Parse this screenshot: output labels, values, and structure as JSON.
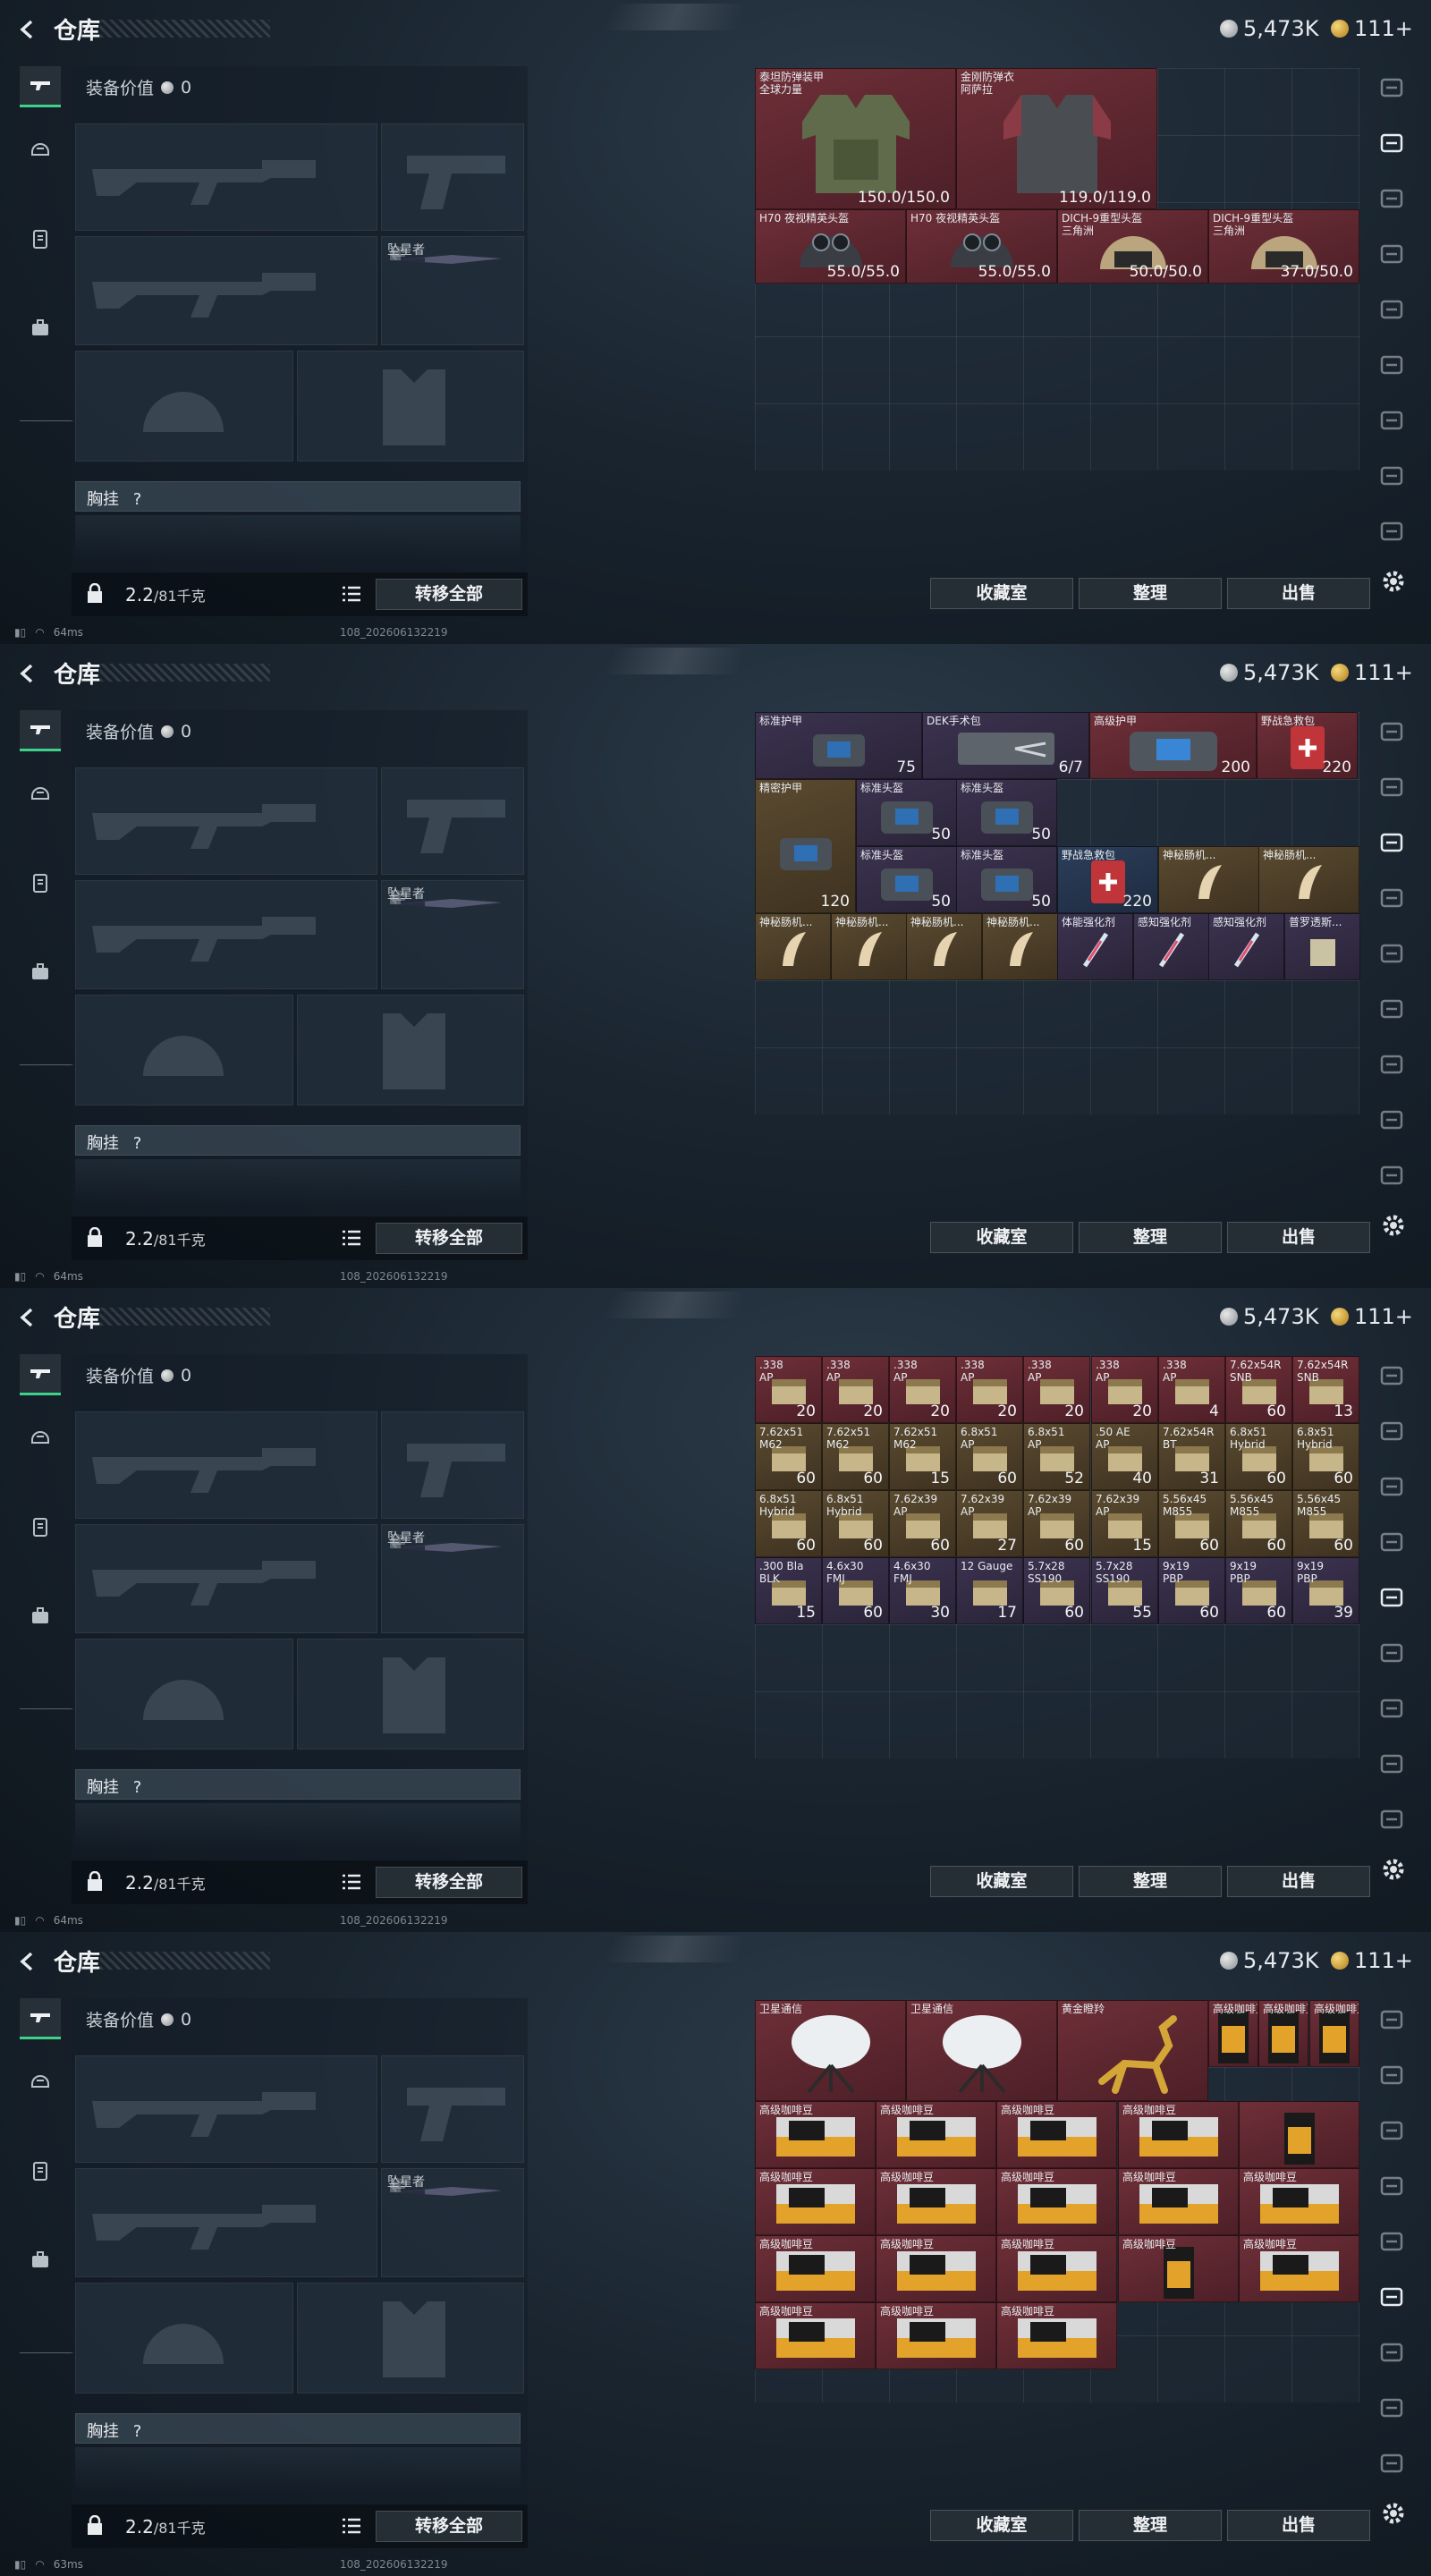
{
  "panels": [
    {
      "title": "仓库",
      "currency": {
        "silver": "5,473K",
        "gold": "111+"
      },
      "equip": {
        "value_label": "装备价值",
        "value": "0",
        "melee_name": "坠星者",
        "chest_label": "胸挂",
        "chest_help": "?",
        "weight": "2.2",
        "weight_max": "/81千克",
        "transfer_label": "转移全部"
      },
      "actions": {
        "collection": "收藏室",
        "sort": "整理",
        "sell": "出售"
      },
      "status": {
        "ping": "64ms",
        "build": "108_202606132219"
      },
      "items": [
        {
          "name": "泰坦防弹装甲",
          "sub": "全球力量",
          "value": "150.0/150.0",
          "rarity": "red",
          "art": "armor-green"
        },
        {
          "name": "金刚防弹衣",
          "sub": "阿萨拉",
          "value": "119.0/119.0",
          "rarity": "red",
          "art": "armor-red"
        },
        {
          "name": "H70 夜视精英头盔",
          "sub": "",
          "value": "55.0/55.0",
          "rarity": "red",
          "art": "helmet-nv"
        },
        {
          "name": "H70 夜视精英头盔",
          "sub": "",
          "value": "55.0/55.0",
          "rarity": "red",
          "art": "helmet-nv"
        },
        {
          "name": "DICH-9重型头盔",
          "sub": "三角洲",
          "value": "50.0/50.0",
          "rarity": "red",
          "art": "helmet-tan"
        },
        {
          "name": "DICH-9重型头盔",
          "sub": "三角洲",
          "value": "37.0/50.0",
          "rarity": "red",
          "art": "helmet-tan"
        }
      ]
    },
    {
      "title": "仓库",
      "currency": {
        "silver": "5,473K",
        "gold": "111+"
      },
      "equip": {
        "value_label": "装备价值",
        "value": "0",
        "melee_name": "坠星者",
        "chest_label": "胸挂",
        "chest_help": "?",
        "weight": "2.2",
        "weight_max": "/81千克",
        "transfer_label": "转移全部"
      },
      "actions": {
        "collection": "收藏室",
        "sort": "整理",
        "sell": "出售"
      },
      "status": {
        "ping": "64ms",
        "build": "108_202606132219"
      },
      "items": [
        {
          "name": "标准护甲",
          "value": "75",
          "rarity": "purple",
          "art": "kit-blue"
        },
        {
          "name": "DEK手术包",
          "value": "6/7",
          "rarity": "purple",
          "art": "surgery"
        },
        {
          "name": "高级护甲",
          "value": "200",
          "rarity": "red",
          "art": "kit-big"
        },
        {
          "name": "野战急救包",
          "value": "220",
          "rarity": "red",
          "art": "medkit"
        },
        {
          "name": "精密护甲",
          "value": "120",
          "rarity": "gold",
          "art": "kit-blue"
        },
        {
          "name": "标准头盔",
          "value": "50",
          "rarity": "purple",
          "art": "kit-small"
        },
        {
          "name": "标准头盔",
          "value": "50",
          "rarity": "purple",
          "art": "kit-small"
        },
        {
          "name": "标准头盔",
          "value": "50",
          "rarity": "purple",
          "art": "kit-small"
        },
        {
          "name": "标准头盔",
          "value": "50",
          "rarity": "purple",
          "art": "kit-small"
        },
        {
          "name": "野战急救包",
          "value": "220",
          "rarity": "blue",
          "art": "medkit"
        },
        {
          "name": "神秘肠机...",
          "value": "",
          "rarity": "gold",
          "art": "horn"
        },
        {
          "name": "神秘肠机...",
          "value": "",
          "rarity": "gold",
          "art": "horn"
        },
        {
          "name": "神秘肠机...",
          "value": "",
          "rarity": "gold",
          "art": "horn"
        },
        {
          "name": "神秘肠机...",
          "value": "",
          "rarity": "gold",
          "art": "horn"
        },
        {
          "name": "神秘肠机...",
          "value": "",
          "rarity": "gold",
          "art": "horn"
        },
        {
          "name": "神秘肠机...",
          "value": "",
          "rarity": "gold",
          "art": "horn"
        },
        {
          "name": "体能强化剂",
          "value": "",
          "rarity": "purple",
          "art": "syringe"
        },
        {
          "name": "感知强化剂",
          "value": "",
          "rarity": "purple",
          "art": "syringe"
        },
        {
          "name": "感知强化剂",
          "value": "",
          "rarity": "purple",
          "art": "syringe"
        },
        {
          "name": "普罗透斯...",
          "value": "",
          "rarity": "purple",
          "art": "bag"
        }
      ]
    },
    {
      "title": "仓库",
      "currency": {
        "silver": "5,473K",
        "gold": "111+"
      },
      "equip": {
        "value_label": "装备价值",
        "value": "0",
        "melee_name": "坠星者",
        "chest_label": "胸挂",
        "chest_help": "?",
        "weight": "2.2",
        "weight_max": "/81千克",
        "transfer_label": "转移全部"
      },
      "actions": {
        "collection": "收藏室",
        "sort": "整理",
        "sell": "出售"
      },
      "status": {
        "ping": "64ms",
        "build": "108_202606132219"
      },
      "items": [
        {
          "name": ".338",
          "sub": "AP",
          "value": "20",
          "rarity": "red"
        },
        {
          "name": ".338",
          "sub": "AP",
          "value": "20",
          "rarity": "red"
        },
        {
          "name": ".338",
          "sub": "AP",
          "value": "20",
          "rarity": "red"
        },
        {
          "name": ".338",
          "sub": "AP",
          "value": "20",
          "rarity": "red"
        },
        {
          "name": ".338",
          "sub": "AP",
          "value": "20",
          "rarity": "red"
        },
        {
          "name": ".338",
          "sub": "AP",
          "value": "20",
          "rarity": "red"
        },
        {
          "name": ".338",
          "sub": "AP",
          "value": "4",
          "rarity": "red"
        },
        {
          "name": "7.62x54R",
          "sub": "SNB",
          "value": "60",
          "rarity": "red"
        },
        {
          "name": "7.62x54R",
          "sub": "SNB",
          "value": "13",
          "rarity": "red"
        },
        {
          "name": "7.62x51",
          "sub": "M62",
          "value": "60",
          "rarity": "gold"
        },
        {
          "name": "7.62x51",
          "sub": "M62",
          "value": "60",
          "rarity": "gold"
        },
        {
          "name": "7.62x51",
          "sub": "M62",
          "value": "15",
          "rarity": "gold"
        },
        {
          "name": "6.8x51",
          "sub": "AP",
          "value": "60",
          "rarity": "gold"
        },
        {
          "name": "6.8x51",
          "sub": "AP",
          "value": "52",
          "rarity": "gold"
        },
        {
          "name": ".50 AE",
          "sub": "AP",
          "value": "40",
          "rarity": "gold"
        },
        {
          "name": "7.62x54R",
          "sub": "BT",
          "value": "31",
          "rarity": "gold"
        },
        {
          "name": "6.8x51",
          "sub": "Hybrid",
          "value": "60",
          "rarity": "gold"
        },
        {
          "name": "6.8x51",
          "sub": "Hybrid",
          "value": "60",
          "rarity": "gold"
        },
        {
          "name": "6.8x51",
          "sub": "Hybrid",
          "value": "60",
          "rarity": "gold"
        },
        {
          "name": "6.8x51",
          "sub": "Hybrid",
          "value": "60",
          "rarity": "gold"
        },
        {
          "name": "7.62x39",
          "sub": "AP",
          "value": "60",
          "rarity": "gold"
        },
        {
          "name": "7.62x39",
          "sub": "AP",
          "value": "27",
          "rarity": "gold"
        },
        {
          "name": "7.62x39",
          "sub": "AP",
          "value": "60",
          "rarity": "gold"
        },
        {
          "name": "7.62x39",
          "sub": "AP",
          "value": "15",
          "rarity": "gold"
        },
        {
          "name": "5.56x45",
          "sub": "M855",
          "value": "60",
          "rarity": "gold"
        },
        {
          "name": "5.56x45",
          "sub": "M855",
          "value": "60",
          "rarity": "gold"
        },
        {
          "name": "5.56x45",
          "sub": "M855",
          "value": "60",
          "rarity": "gold"
        },
        {
          "name": ".300 Bla",
          "sub": "BLK",
          "value": "15",
          "rarity": "purple"
        },
        {
          "name": "4.6x30",
          "sub": "FMJ",
          "value": "60",
          "rarity": "purple"
        },
        {
          "name": "4.6x30",
          "sub": "FMJ",
          "value": "30",
          "rarity": "purple"
        },
        {
          "name": "12 Gauge",
          "sub": "",
          "value": "17",
          "rarity": "purple"
        },
        {
          "name": "5.7x28",
          "sub": "SS190",
          "value": "60",
          "rarity": "purple"
        },
        {
          "name": "5.7x28",
          "sub": "SS190",
          "value": "55",
          "rarity": "purple"
        },
        {
          "name": "9x19",
          "sub": "PBP",
          "value": "60",
          "rarity": "purple"
        },
        {
          "name": "9x19",
          "sub": "PBP",
          "value": "60",
          "rarity": "purple"
        },
        {
          "name": "9x19",
          "sub": "PBP",
          "value": "39",
          "rarity": "purple"
        }
      ]
    },
    {
      "title": "仓库",
      "currency": {
        "silver": "5,473K",
        "gold": "111+"
      },
      "equip": {
        "value_label": "装备价值",
        "value": "0",
        "melee_name": "坠星者",
        "chest_label": "胸挂",
        "chest_help": "?",
        "weight": "2.2",
        "weight_max": "/81千克",
        "transfer_label": "转移全部"
      },
      "actions": {
        "collection": "收藏室",
        "sort": "整理",
        "sell": "出售"
      },
      "status": {
        "ping": "63ms",
        "build": "108_202606132219"
      },
      "items": [
        {
          "name": "卫星通信",
          "value": "",
          "rarity": "red",
          "art": "dish"
        },
        {
          "name": "卫星通信",
          "value": "",
          "rarity": "red",
          "art": "dish"
        },
        {
          "name": "黄金瞪羚",
          "value": "",
          "rarity": "red",
          "art": "gazelle"
        },
        {
          "name": "高级咖啡豆",
          "value": "",
          "rarity": "red",
          "art": "coffee-bag"
        },
        {
          "name": "高级咖啡豆",
          "value": "",
          "rarity": "red",
          "art": "coffee-bag"
        },
        {
          "name": "高级咖啡豆",
          "value": "",
          "rarity": "red",
          "art": "coffee-bag"
        },
        {
          "name": "高级咖啡豆",
          "value": "",
          "rarity": "red",
          "art": "coffee-box"
        },
        {
          "name": "高级咖啡豆",
          "value": "",
          "rarity": "red",
          "art": "coffee-box"
        },
        {
          "name": "高级咖啡豆",
          "value": "",
          "rarity": "red",
          "art": "coffee-box"
        },
        {
          "name": "高级咖啡豆",
          "value": "",
          "rarity": "red",
          "art": "coffee-box"
        },
        {
          "name": "",
          "value": "",
          "rarity": "red",
          "art": "coffee-bag"
        },
        {
          "name": "高级咖啡豆",
          "value": "",
          "rarity": "red",
          "art": "coffee-box"
        },
        {
          "name": "高级咖啡豆",
          "value": "",
          "rarity": "red",
          "art": "coffee-box"
        },
        {
          "name": "高级咖啡豆",
          "value": "",
          "rarity": "red",
          "art": "coffee-box"
        },
        {
          "name": "高级咖啡豆",
          "value": "",
          "rarity": "red",
          "art": "coffee-box"
        },
        {
          "name": "高级咖啡豆",
          "value": "",
          "rarity": "red",
          "art": "coffee-box"
        },
        {
          "name": "高级咖啡豆",
          "value": "",
          "rarity": "red",
          "art": "coffee-box"
        },
        {
          "name": "高级咖啡豆",
          "value": "",
          "rarity": "red",
          "art": "coffee-box"
        },
        {
          "name": "高级咖啡豆",
          "value": "",
          "rarity": "red",
          "art": "coffee-box"
        },
        {
          "name": "高级咖啡豆",
          "value": "",
          "rarity": "red",
          "art": "coffee-bag"
        },
        {
          "name": "高级咖啡豆",
          "value": "",
          "rarity": "red",
          "art": "coffee-box"
        },
        {
          "name": "高级咖啡豆",
          "value": "",
          "rarity": "red",
          "art": "coffee-box"
        },
        {
          "name": "高级咖啡豆",
          "value": "",
          "rarity": "red",
          "art": "coffee-box"
        },
        {
          "name": "高级咖啡豆",
          "value": "",
          "rarity": "red",
          "art": "coffee-box"
        }
      ]
    }
  ],
  "colors": {
    "rarity_red": "#6e2f38",
    "rarity_purple": "#3c3350",
    "rarity_gold": "#5a4a30",
    "rarity_blue": "#2c3e5a",
    "accent_green": "#3fd08a"
  },
  "icons": {
    "tabs": [
      "gun-icon",
      "helmet-icon",
      "vest-icon",
      "backpack-icon"
    ],
    "right_rail": [
      "helmet-icon",
      "vest-icon",
      "armor-icon",
      "ammo-icon",
      "folder-icon",
      "camera-icon",
      "ammo-icon",
      "tag-icon",
      "tag-icon"
    ]
  }
}
